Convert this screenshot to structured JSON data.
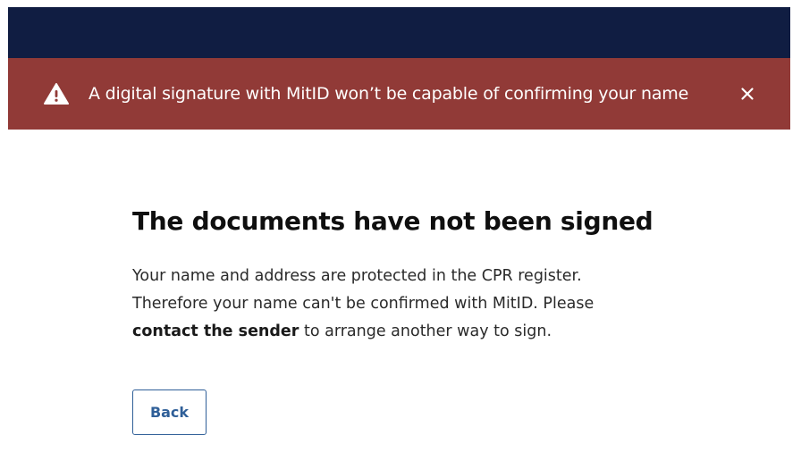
{
  "alert": {
    "icon": "warning-triangle-icon",
    "message": "A digital signature with MitID won’t be capable of confirming your name",
    "close_icon": "close-icon",
    "background": "#913a37"
  },
  "header": {
    "background": "#101d42"
  },
  "main": {
    "title": "The documents have not been signed",
    "paragraph_lines": [
      "Your name and address are protected in the CPR register.",
      "Therefore your name can't be confirmed with MitID. Please"
    ],
    "contact_link": "contact the sender",
    "paragraph_end": " to arrange another way to sign."
  },
  "actions": {
    "back_label": "Back",
    "accent": "#2f5f98"
  }
}
